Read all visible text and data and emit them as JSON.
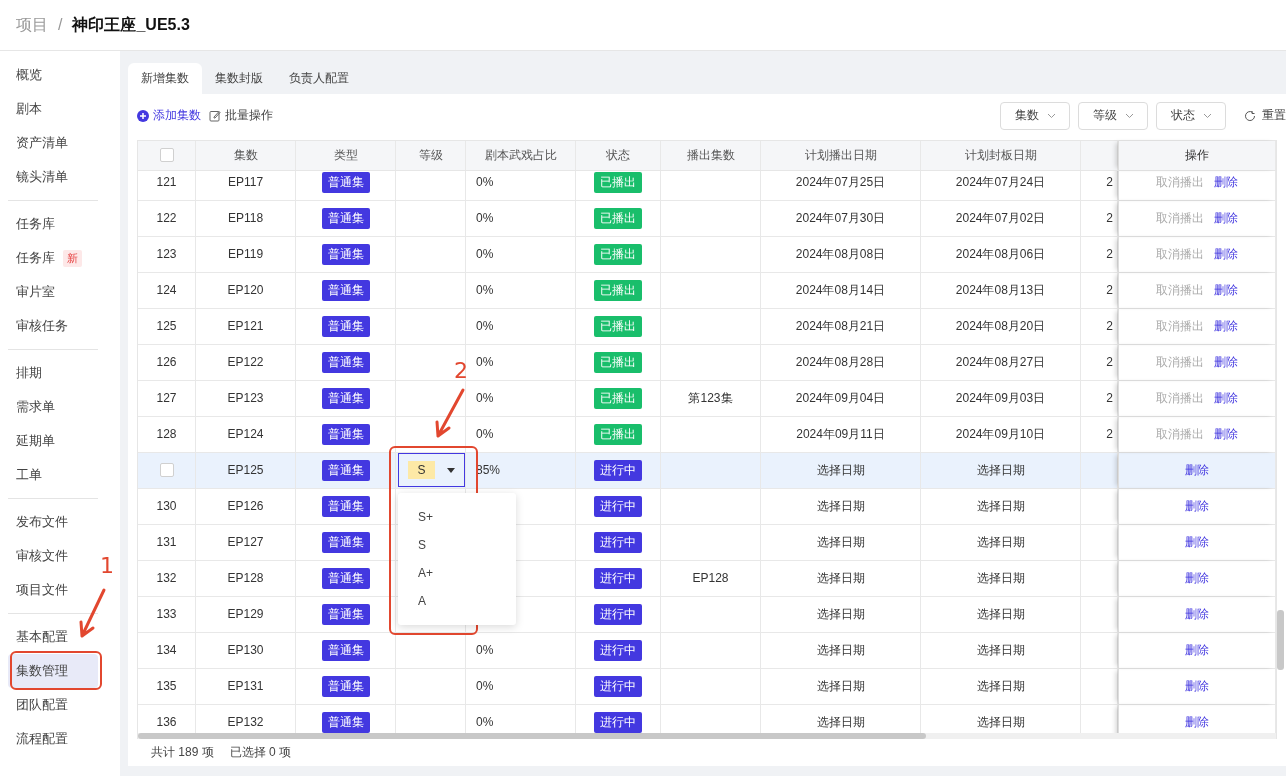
{
  "breadcrumb": {
    "parent": "项目",
    "separator": "/",
    "title": "神印王座_UE5.3"
  },
  "sidebar": {
    "groups": [
      {
        "items": [
          {
            "label": "概览",
            "selected": false
          },
          {
            "label": "剧本",
            "selected": false
          },
          {
            "label": "资产清单",
            "selected": false
          },
          {
            "label": "镜头清单",
            "selected": false
          }
        ]
      },
      {
        "items": [
          {
            "label": "任务库",
            "selected": false
          },
          {
            "label": "任务库",
            "badge": "新",
            "selected": false
          },
          {
            "label": "审片室",
            "selected": false
          },
          {
            "label": "审核任务",
            "selected": false
          }
        ]
      },
      {
        "items": [
          {
            "label": "排期",
            "selected": false
          },
          {
            "label": "需求单",
            "selected": false
          },
          {
            "label": "延期单",
            "selected": false
          },
          {
            "label": "工单",
            "selected": false
          }
        ]
      },
      {
        "items": [
          {
            "label": "发布文件",
            "selected": false
          },
          {
            "label": "审核文件",
            "selected": false
          },
          {
            "label": "项目文件",
            "selected": false
          }
        ]
      },
      {
        "items": [
          {
            "label": "基本配置",
            "selected": false
          },
          {
            "label": "集数管理",
            "selected": true
          },
          {
            "label": "团队配置",
            "selected": false
          },
          {
            "label": "流程配置",
            "selected": false
          }
        ]
      }
    ]
  },
  "tabs": [
    {
      "label": "新增集数",
      "selected": true
    },
    {
      "label": "集数封版",
      "selected": false
    },
    {
      "label": "负责人配置",
      "selected": false
    }
  ],
  "toolbar": {
    "actions": [
      {
        "label": "添加集数",
        "kind": "add"
      },
      {
        "label": "批量操作",
        "kind": "batch"
      }
    ],
    "filters": [
      {
        "label": "集数"
      },
      {
        "label": "等级"
      },
      {
        "label": "状态"
      }
    ],
    "reset": "重置"
  },
  "table": {
    "select_all": {
      "checked": false
    },
    "columns": [
      "集数",
      "类型",
      "等级",
      "剧本武戏占比",
      "状态",
      "播出集数",
      "计划播出日期",
      "计划封板日期"
    ],
    "action_column": "操作",
    "rows": [
      {
        "index": "121",
        "episode": "EP117",
        "type": "普通集",
        "ratio": "0%",
        "status": {
          "label": "已播出",
          "color": "#19be6b"
        },
        "air_date": "2024年07月25日",
        "seal_date": "2024年07月24日",
        "column_10": "2",
        "actions": [
          {
            "label": "取消播出",
            "kind": "muted"
          },
          {
            "label": "删除",
            "kind": "link"
          }
        ],
        "highlighted": false
      },
      {
        "index": "122",
        "episode": "EP118",
        "type": "普通集",
        "ratio": "0%",
        "status": {
          "label": "已播出",
          "color": "#19be6b"
        },
        "air_date": "2024年07月30日",
        "seal_date": "2024年07月02日",
        "column_10": "2",
        "actions": [
          {
            "label": "取消播出",
            "kind": "muted"
          },
          {
            "label": "删除",
            "kind": "link"
          }
        ],
        "highlighted": false
      },
      {
        "index": "123",
        "episode": "EP119",
        "type": "普通集",
        "ratio": "0%",
        "status": {
          "label": "已播出",
          "color": "#19be6b"
        },
        "air_date": "2024年08月08日",
        "seal_date": "2024年08月06日",
        "column_10": "2",
        "actions": [
          {
            "label": "取消播出",
            "kind": "muted"
          },
          {
            "label": "删除",
            "kind": "link"
          }
        ],
        "highlighted": false
      },
      {
        "index": "124",
        "episode": "EP120",
        "type": "普通集",
        "ratio": "0%",
        "status": {
          "label": "已播出",
          "color": "#19be6b"
        },
        "air_date": "2024年08月14日",
        "seal_date": "2024年08月13日",
        "column_10": "2",
        "actions": [
          {
            "label": "取消播出",
            "kind": "muted"
          },
          {
            "label": "删除",
            "kind": "link"
          }
        ],
        "highlighted": false
      },
      {
        "index": "125",
        "episode": "EP121",
        "type": "普通集",
        "ratio": "0%",
        "status": {
          "label": "已播出",
          "color": "#19be6b"
        },
        "air_date": "2024年08月21日",
        "seal_date": "2024年08月20日",
        "column_10": "2",
        "actions": [
          {
            "label": "取消播出",
            "kind": "muted"
          },
          {
            "label": "删除",
            "kind": "link"
          }
        ],
        "highlighted": false
      },
      {
        "index": "126",
        "episode": "EP122",
        "type": "普通集",
        "ratio": "0%",
        "status": {
          "label": "已播出",
          "color": "#19be6b"
        },
        "air_date": "2024年08月28日",
        "seal_date": "2024年08月27日",
        "column_10": "2",
        "actions": [
          {
            "label": "取消播出",
            "kind": "muted"
          },
          {
            "label": "删除",
            "kind": "link"
          }
        ],
        "highlighted": false
      },
      {
        "index": "127",
        "episode": "EP123",
        "type": "普通集",
        "ratio": "0%",
        "status": {
          "label": "已播出",
          "color": "#19be6b"
        },
        "broadcast": "第123集",
        "air_date": "2024年09月04日",
        "seal_date": "2024年09月03日",
        "column_10": "2",
        "actions": [
          {
            "label": "取消播出",
            "kind": "muted"
          },
          {
            "label": "删除",
            "kind": "link"
          }
        ],
        "highlighted": false
      },
      {
        "index": "128",
        "episode": "EP124",
        "type": "普通集",
        "ratio": "0%",
        "status": {
          "label": "已播出",
          "color": "#19be6b"
        },
        "air_date": "2024年09月11日",
        "seal_date": "2024年09月10日",
        "column_10": "2",
        "actions": [
          {
            "label": "取消播出",
            "kind": "muted"
          },
          {
            "label": "删除",
            "kind": "link"
          }
        ],
        "highlighted": false
      },
      {
        "episode": "EP125",
        "type": "普通集",
        "grade": {
          "value": "S",
          "options": [
            {
              "label": "S+"
            },
            {
              "label": "S"
            },
            {
              "label": "A+"
            },
            {
              "label": "A"
            }
          ]
        },
        "ratio": "85%",
        "status": {
          "label": "进行中",
          "color": "#4338e0"
        },
        "air_date": "选择日期",
        "seal_date": "选择日期",
        "actions": [
          {
            "label": "删除",
            "kind": "link"
          }
        ],
        "highlighted": true,
        "checked": false
      },
      {
        "index": "130",
        "episode": "EP126",
        "type": "普通集",
        "status": {
          "label": "进行中",
          "color": "#4338e0"
        },
        "air_date": "选择日期",
        "seal_date": "选择日期",
        "actions": [
          {
            "label": "删除",
            "kind": "link"
          }
        ],
        "highlighted": false
      },
      {
        "index": "131",
        "episode": "EP127",
        "type": "普通集",
        "status": {
          "label": "进行中",
          "color": "#4338e0"
        },
        "air_date": "选择日期",
        "seal_date": "选择日期",
        "actions": [
          {
            "label": "删除",
            "kind": "link"
          }
        ],
        "highlighted": false
      },
      {
        "index": "132",
        "episode": "EP128",
        "type": "普通集",
        "status": {
          "label": "进行中",
          "color": "#4338e0"
        },
        "broadcast": "EP128",
        "air_date": "选择日期",
        "seal_date": "选择日期",
        "actions": [
          {
            "label": "删除",
            "kind": "link"
          }
        ],
        "highlighted": false
      },
      {
        "index": "133",
        "episode": "EP129",
        "type": "普通集",
        "status": {
          "label": "进行中",
          "color": "#4338e0"
        },
        "air_date": "选择日期",
        "seal_date": "选择日期",
        "actions": [
          {
            "label": "删除",
            "kind": "link"
          }
        ],
        "highlighted": false
      },
      {
        "index": "134",
        "episode": "EP130",
        "type": "普通集",
        "ratio": "0%",
        "status": {
          "label": "进行中",
          "color": "#4338e0"
        },
        "air_date": "选择日期",
        "seal_date": "选择日期",
        "actions": [
          {
            "label": "删除",
            "kind": "link"
          }
        ],
        "highlighted": false
      },
      {
        "index": "135",
        "episode": "EP131",
        "type": "普通集",
        "ratio": "0%",
        "status": {
          "label": "进行中",
          "color": "#4338e0"
        },
        "air_date": "选择日期",
        "seal_date": "选择日期",
        "actions": [
          {
            "label": "删除",
            "kind": "link"
          }
        ],
        "highlighted": false
      },
      {
        "index": "136",
        "episode": "EP132",
        "type": "普通集",
        "ratio": "0%",
        "status": {
          "label": "进行中",
          "color": "#4338e0"
        },
        "air_date": "选择日期",
        "seal_date": "选择日期",
        "actions": [
          {
            "label": "删除",
            "kind": "link"
          }
        ],
        "highlighted": false
      }
    ]
  },
  "footer": {
    "total": "共计 189 项",
    "selected": "已选择 0 项"
  },
  "annotations": [
    {
      "label": "1"
    },
    {
      "label": "2"
    }
  ]
}
